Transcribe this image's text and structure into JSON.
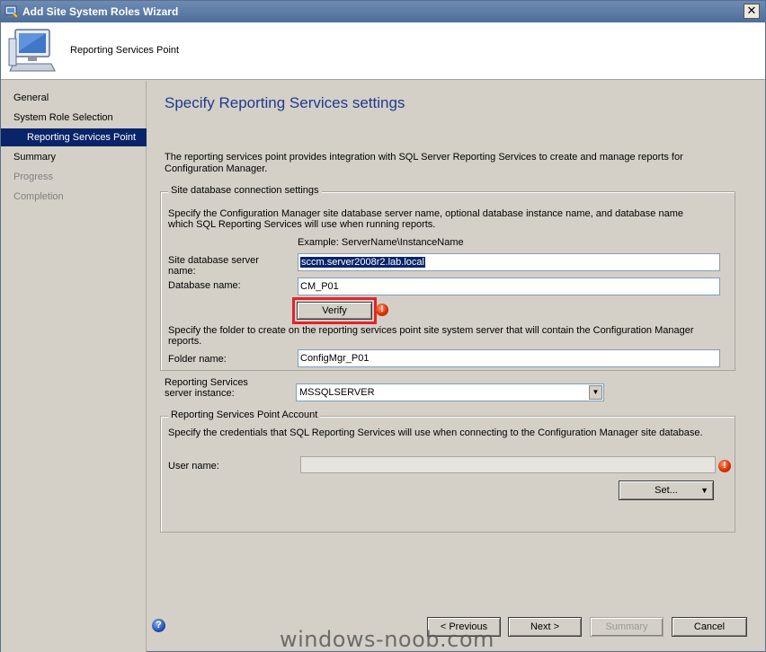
{
  "window": {
    "title": "Add Site System Roles Wizard",
    "close_glyph": "✕"
  },
  "header": {
    "title": "Reporting Services Point"
  },
  "sidebar": {
    "items": [
      {
        "label": "General",
        "state": "normal"
      },
      {
        "label": "System Role Selection",
        "state": "normal"
      },
      {
        "label": "Reporting Services Point",
        "state": "active"
      },
      {
        "label": "Summary",
        "state": "normal"
      },
      {
        "label": "Progress",
        "state": "disabled"
      },
      {
        "label": "Completion",
        "state": "disabled"
      }
    ]
  },
  "main": {
    "title": "Specify Reporting Services settings",
    "description": "The reporting services point provides integration with SQL Server Reporting Services to create and manage reports for Configuration Manager.",
    "site_db_group": {
      "label": "Site database connection settings",
      "instructions": "Specify the Configuration Manager site database server name, optional database instance name, and database name which SQL Reporting Services will use when running reports.",
      "example": "Example: ServerName\\InstanceName",
      "server_label": "Site database server name:",
      "server_value": "sccm.server2008r2.lab.local",
      "dbname_label": "Database name:",
      "dbname_value": "CM_P01",
      "verify_label": "Verify",
      "folder_instructions": "Specify the folder to create on the reporting services point site system server that will contain the Configuration Manager reports.",
      "folder_label": "Folder name:",
      "folder_value": "ConfigMgr_P01"
    },
    "instance": {
      "label": "Reporting Services server instance:",
      "value": "MSSQLSERVER"
    },
    "account_group": {
      "label": "Reporting Services Point Account",
      "instructions": "Specify the credentials that SQL Reporting Services will use when connecting to the Configuration Manager site database.",
      "username_label": "User name:",
      "username_value": "",
      "set_label": "Set...",
      "set_arrow": "▼"
    }
  },
  "footer": {
    "help_glyph": "?",
    "previous_label": "< Previous",
    "next_label": "Next >",
    "summary_label": "Summary",
    "cancel_label": "Cancel"
  },
  "watermark": "windows-noob.com",
  "colors": {
    "title_blue": "#1f3a8c",
    "selection": "#0a246a",
    "highlight": "#e8212a"
  }
}
